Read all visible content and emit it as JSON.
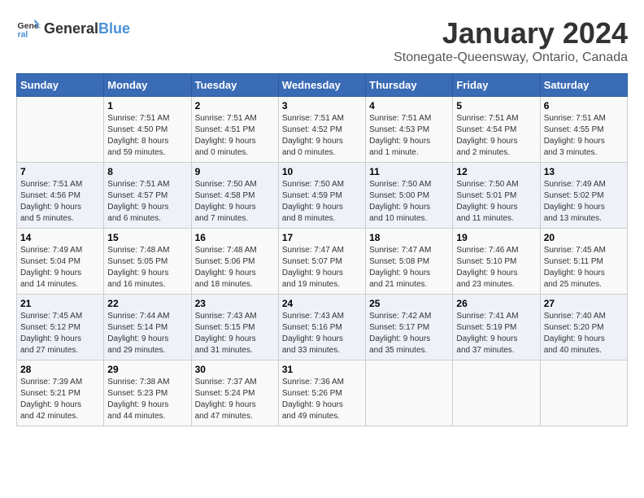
{
  "header": {
    "logo_general": "General",
    "logo_blue": "Blue",
    "main_title": "January 2024",
    "sub_title": "Stonegate-Queensway, Ontario, Canada"
  },
  "days_of_week": [
    "Sunday",
    "Monday",
    "Tuesday",
    "Wednesday",
    "Thursday",
    "Friday",
    "Saturday"
  ],
  "weeks": [
    [
      {
        "day": "",
        "info": ""
      },
      {
        "day": "1",
        "info": "Sunrise: 7:51 AM\nSunset: 4:50 PM\nDaylight: 8 hours\nand 59 minutes."
      },
      {
        "day": "2",
        "info": "Sunrise: 7:51 AM\nSunset: 4:51 PM\nDaylight: 9 hours\nand 0 minutes."
      },
      {
        "day": "3",
        "info": "Sunrise: 7:51 AM\nSunset: 4:52 PM\nDaylight: 9 hours\nand 0 minutes."
      },
      {
        "day": "4",
        "info": "Sunrise: 7:51 AM\nSunset: 4:53 PM\nDaylight: 9 hours\nand 1 minute."
      },
      {
        "day": "5",
        "info": "Sunrise: 7:51 AM\nSunset: 4:54 PM\nDaylight: 9 hours\nand 2 minutes."
      },
      {
        "day": "6",
        "info": "Sunrise: 7:51 AM\nSunset: 4:55 PM\nDaylight: 9 hours\nand 3 minutes."
      }
    ],
    [
      {
        "day": "7",
        "info": "Sunrise: 7:51 AM\nSunset: 4:56 PM\nDaylight: 9 hours\nand 5 minutes."
      },
      {
        "day": "8",
        "info": "Sunrise: 7:51 AM\nSunset: 4:57 PM\nDaylight: 9 hours\nand 6 minutes."
      },
      {
        "day": "9",
        "info": "Sunrise: 7:50 AM\nSunset: 4:58 PM\nDaylight: 9 hours\nand 7 minutes."
      },
      {
        "day": "10",
        "info": "Sunrise: 7:50 AM\nSunset: 4:59 PM\nDaylight: 9 hours\nand 8 minutes."
      },
      {
        "day": "11",
        "info": "Sunrise: 7:50 AM\nSunset: 5:00 PM\nDaylight: 9 hours\nand 10 minutes."
      },
      {
        "day": "12",
        "info": "Sunrise: 7:50 AM\nSunset: 5:01 PM\nDaylight: 9 hours\nand 11 minutes."
      },
      {
        "day": "13",
        "info": "Sunrise: 7:49 AM\nSunset: 5:02 PM\nDaylight: 9 hours\nand 13 minutes."
      }
    ],
    [
      {
        "day": "14",
        "info": "Sunrise: 7:49 AM\nSunset: 5:04 PM\nDaylight: 9 hours\nand 14 minutes."
      },
      {
        "day": "15",
        "info": "Sunrise: 7:48 AM\nSunset: 5:05 PM\nDaylight: 9 hours\nand 16 minutes."
      },
      {
        "day": "16",
        "info": "Sunrise: 7:48 AM\nSunset: 5:06 PM\nDaylight: 9 hours\nand 18 minutes."
      },
      {
        "day": "17",
        "info": "Sunrise: 7:47 AM\nSunset: 5:07 PM\nDaylight: 9 hours\nand 19 minutes."
      },
      {
        "day": "18",
        "info": "Sunrise: 7:47 AM\nSunset: 5:08 PM\nDaylight: 9 hours\nand 21 minutes."
      },
      {
        "day": "19",
        "info": "Sunrise: 7:46 AM\nSunset: 5:10 PM\nDaylight: 9 hours\nand 23 minutes."
      },
      {
        "day": "20",
        "info": "Sunrise: 7:45 AM\nSunset: 5:11 PM\nDaylight: 9 hours\nand 25 minutes."
      }
    ],
    [
      {
        "day": "21",
        "info": "Sunrise: 7:45 AM\nSunset: 5:12 PM\nDaylight: 9 hours\nand 27 minutes."
      },
      {
        "day": "22",
        "info": "Sunrise: 7:44 AM\nSunset: 5:14 PM\nDaylight: 9 hours\nand 29 minutes."
      },
      {
        "day": "23",
        "info": "Sunrise: 7:43 AM\nSunset: 5:15 PM\nDaylight: 9 hours\nand 31 minutes."
      },
      {
        "day": "24",
        "info": "Sunrise: 7:43 AM\nSunset: 5:16 PM\nDaylight: 9 hours\nand 33 minutes."
      },
      {
        "day": "25",
        "info": "Sunrise: 7:42 AM\nSunset: 5:17 PM\nDaylight: 9 hours\nand 35 minutes."
      },
      {
        "day": "26",
        "info": "Sunrise: 7:41 AM\nSunset: 5:19 PM\nDaylight: 9 hours\nand 37 minutes."
      },
      {
        "day": "27",
        "info": "Sunrise: 7:40 AM\nSunset: 5:20 PM\nDaylight: 9 hours\nand 40 minutes."
      }
    ],
    [
      {
        "day": "28",
        "info": "Sunrise: 7:39 AM\nSunset: 5:21 PM\nDaylight: 9 hours\nand 42 minutes."
      },
      {
        "day": "29",
        "info": "Sunrise: 7:38 AM\nSunset: 5:23 PM\nDaylight: 9 hours\nand 44 minutes."
      },
      {
        "day": "30",
        "info": "Sunrise: 7:37 AM\nSunset: 5:24 PM\nDaylight: 9 hours\nand 47 minutes."
      },
      {
        "day": "31",
        "info": "Sunrise: 7:36 AM\nSunset: 5:26 PM\nDaylight: 9 hours\nand 49 minutes."
      },
      {
        "day": "",
        "info": ""
      },
      {
        "day": "",
        "info": ""
      },
      {
        "day": "",
        "info": ""
      }
    ]
  ]
}
